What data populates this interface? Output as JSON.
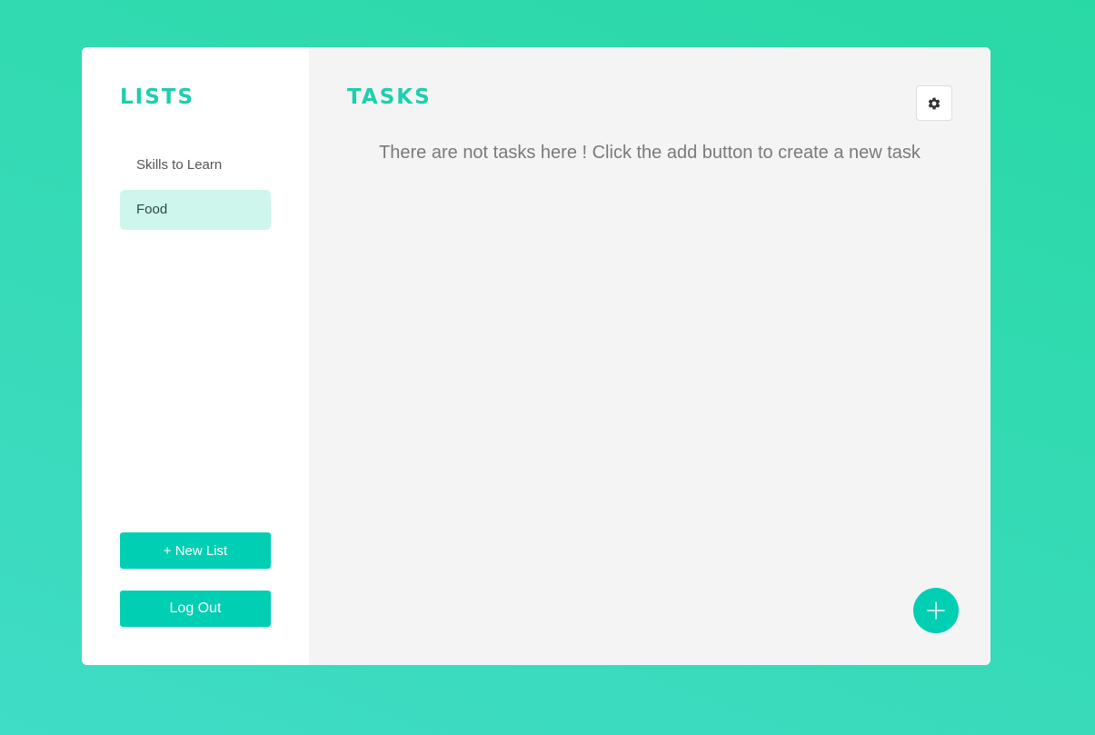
{
  "sidebar": {
    "heading": "LISTS",
    "items": [
      {
        "label": "Skills to Learn",
        "active": false
      },
      {
        "label": "Food",
        "active": true
      }
    ],
    "new_list_label": "+ New List",
    "logout_label": "Log Out"
  },
  "main": {
    "heading": "TASKS",
    "empty_message": "There are not tasks here ! Click the add button to create a new task",
    "settings_icon": "gear-icon",
    "add_icon": "plus-icon"
  },
  "colors": {
    "accent": "#00cfb3",
    "heading": "#1ccfae",
    "active_item_bg": "#cff6ec",
    "main_bg": "#f4f4f4"
  }
}
